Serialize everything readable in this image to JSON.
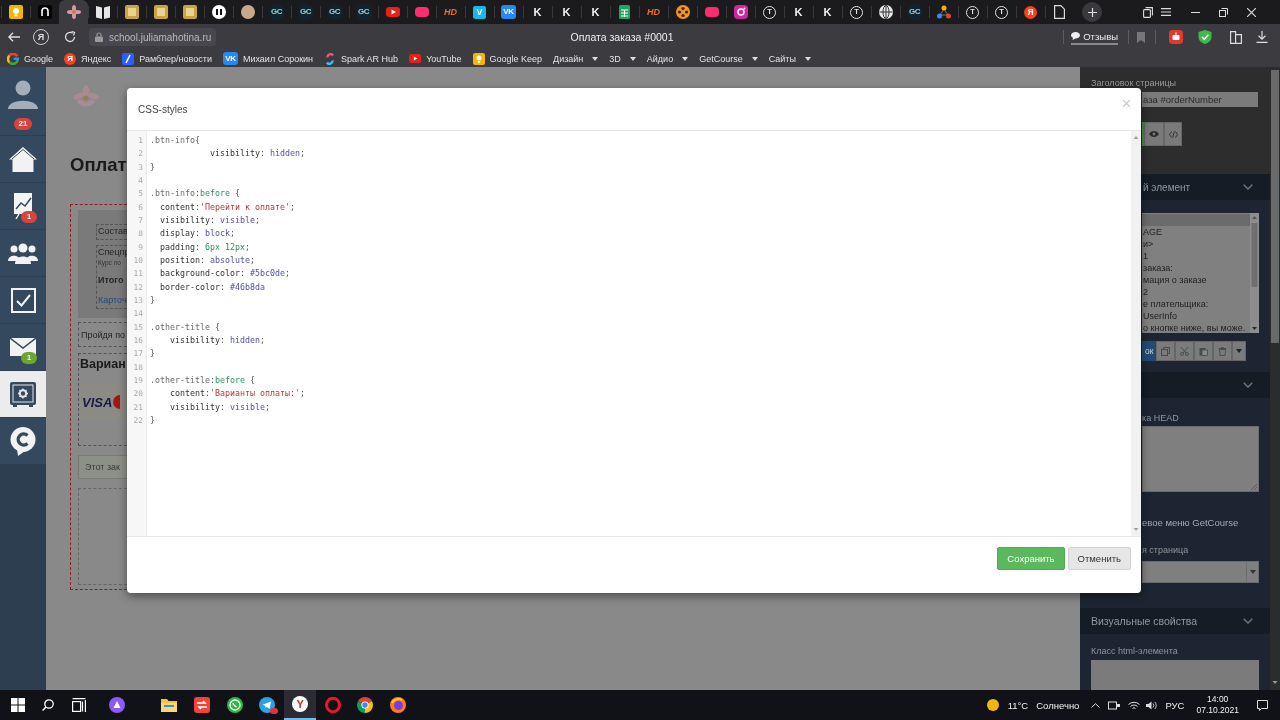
{
  "browser": {
    "tabs": [
      {
        "kind": "keep",
        "selected": false
      },
      {
        "kind": "portal",
        "selected": false
      },
      {
        "kind": "flower",
        "selected": true
      },
      {
        "kind": "book",
        "selected": false
      },
      {
        "kind": "frame",
        "selected": false
      },
      {
        "kind": "frame",
        "selected": false
      },
      {
        "kind": "frame",
        "selected": false
      },
      {
        "kind": "pause",
        "selected": false
      },
      {
        "kind": "avatar",
        "selected": false
      },
      {
        "kind": "gc",
        "glyph": "GC",
        "selected": false
      },
      {
        "kind": "gc",
        "glyph": "GC",
        "selected": false
      },
      {
        "kind": "gc",
        "glyph": "GC",
        "selected": false
      },
      {
        "kind": "gc",
        "glyph": "GC",
        "selected": false
      },
      {
        "kind": "youtube",
        "selected": false
      },
      {
        "kind": "blob",
        "selected": false
      },
      {
        "kind": "hd",
        "glyph": "HD",
        "selected": false
      },
      {
        "kind": "vimeo",
        "glyph": "V",
        "selected": false
      },
      {
        "kind": "vk",
        "glyph": "VK",
        "selected": false
      },
      {
        "kind": "k",
        "glyph": "K",
        "selected": false
      },
      {
        "kind": "k",
        "glyph": "K",
        "selected": false
      },
      {
        "kind": "k",
        "glyph": "K",
        "selected": false
      },
      {
        "kind": "sheet",
        "selected": false
      },
      {
        "kind": "hd",
        "glyph": "HD",
        "selected": false
      },
      {
        "kind": "reel",
        "selected": false
      },
      {
        "kind": "blob",
        "selected": false
      },
      {
        "kind": "instagram",
        "selected": false
      },
      {
        "kind": "t",
        "glyph": "T",
        "selected": false
      },
      {
        "kind": "k",
        "glyph": "K",
        "selected": false
      },
      {
        "kind": "k",
        "glyph": "K",
        "selected": false
      },
      {
        "kind": "t",
        "glyph": "T",
        "selected": false
      },
      {
        "kind": "globe",
        "selected": false
      },
      {
        "kind": "gc",
        "glyph": "GC",
        "selected": false
      },
      {
        "kind": "dots",
        "selected": false
      },
      {
        "kind": "t",
        "glyph": "T",
        "selected": false
      },
      {
        "kind": "t",
        "glyph": "T",
        "selected": false
      },
      {
        "kind": "ya",
        "glyph": "Я",
        "selected": false
      },
      {
        "kind": "doc",
        "selected": false
      }
    ],
    "address": {
      "home_glyph": "Я",
      "url": "school.juliamahotina.ru",
      "title": "Оплата заказа #0001",
      "reviews": "Отзывы"
    },
    "bookmarks": [
      {
        "kind": "google",
        "label": "Google"
      },
      {
        "kind": "yandex",
        "glyph": "Я",
        "label": "Яндекс"
      },
      {
        "kind": "rambler",
        "label": "Рамблер/новости"
      },
      {
        "kind": "vk",
        "glyph": "VK",
        "label": "Михаил Сорокин"
      },
      {
        "kind": "spark",
        "label": "Spark AR Hub"
      },
      {
        "kind": "youtube",
        "label": "YouTube"
      },
      {
        "kind": "keep",
        "label": "Google Keep"
      },
      {
        "kind": "folder",
        "label": "Дизайн"
      },
      {
        "kind": "folder",
        "label": "3D"
      },
      {
        "kind": "folder",
        "label": "Айдио"
      },
      {
        "kind": "folder",
        "label": "GetCourse"
      },
      {
        "kind": "folder",
        "label": "Сайты"
      }
    ]
  },
  "sidebar": {
    "notifications": "21",
    "items": [
      {
        "kind": "home",
        "selected": false
      },
      {
        "kind": "chart",
        "badge": "1",
        "color": "#d9433c",
        "selected": false
      },
      {
        "kind": "users",
        "selected": false
      },
      {
        "kind": "tasks",
        "selected": false
      },
      {
        "kind": "mail",
        "badge": "1",
        "color": "#6da532",
        "selected": false
      },
      {
        "kind": "safe",
        "selected": true
      },
      {
        "kind": "chat",
        "selected": false
      }
    ]
  },
  "page": {
    "title": "Оплат",
    "summary": [
      {
        "lines": [
          {
            "kind": "label",
            "text": "Состав"
          }
        ]
      },
      {
        "lines": [
          {
            "kind": "label",
            "text": "Спецпр"
          },
          {
            "kind": "small",
            "text": "Курс по"
          },
          {
            "kind": "total",
            "text": "Итого"
          },
          {
            "kind": "link",
            "text": "Карточ"
          }
        ]
      }
    ],
    "note": "Пройдя по",
    "payment_title": "Вариан",
    "card_logo": "VISA",
    "notice": "Этот зак"
  },
  "modal": {
    "title": "CSS-styles",
    "lines": [
      {
        "number": "1",
        "tokens": [
          {
            "kind": "qualifier",
            "text": ".btn-info"
          },
          {
            "kind": "plain",
            "text": "{"
          }
        ]
      },
      {
        "number": "2",
        "tokens": [
          {
            "kind": "property",
            "text": "            visibility"
          },
          {
            "kind": "plain",
            "text": ": "
          },
          {
            "kind": "atom",
            "text": "hidden"
          },
          {
            "kind": "plain",
            "text": ";"
          }
        ]
      },
      {
        "number": "3",
        "tokens": [
          {
            "kind": "plain",
            "text": "}"
          }
        ]
      },
      {
        "number": "4"
      },
      {
        "number": "5",
        "tokens": [
          {
            "kind": "qualifier",
            "text": ".btn-info"
          },
          {
            "kind": "plain",
            "text": ":"
          },
          {
            "kind": "pseudo",
            "text": "before"
          },
          {
            "kind": "plain",
            "text": " {"
          }
        ]
      },
      {
        "number": "6",
        "tokens": [
          {
            "kind": "property",
            "text": "  content"
          },
          {
            "kind": "plain",
            "text": ":"
          },
          {
            "kind": "string",
            "text": "'Перейти к оплате'"
          },
          {
            "kind": "plain",
            "text": ";"
          }
        ]
      },
      {
        "number": "7",
        "tokens": [
          {
            "kind": "property",
            "text": "  visibility"
          },
          {
            "kind": "plain",
            "text": ": "
          },
          {
            "kind": "atom",
            "text": "visible"
          },
          {
            "kind": "plain",
            "text": ";"
          }
        ]
      },
      {
        "number": "8",
        "tokens": [
          {
            "kind": "property",
            "text": "  display"
          },
          {
            "kind": "plain",
            "text": ": "
          },
          {
            "kind": "atom",
            "text": "block"
          },
          {
            "kind": "plain",
            "text": ";"
          }
        ]
      },
      {
        "number": "9",
        "tokens": [
          {
            "kind": "property",
            "text": "  padding"
          },
          {
            "kind": "plain",
            "text": ": "
          },
          {
            "kind": "number",
            "text": "6px 12px"
          },
          {
            "kind": "plain",
            "text": ";"
          }
        ]
      },
      {
        "number": "10",
        "tokens": [
          {
            "kind": "property",
            "text": "  position"
          },
          {
            "kind": "plain",
            "text": ": "
          },
          {
            "kind": "atom",
            "text": "absolute"
          },
          {
            "kind": "plain",
            "text": ";"
          }
        ]
      },
      {
        "number": "11",
        "tokens": [
          {
            "kind": "property",
            "text": "  background-color"
          },
          {
            "kind": "plain",
            "text": ": "
          },
          {
            "kind": "atom",
            "text": "#5bc0de"
          },
          {
            "kind": "plain",
            "text": ";"
          }
        ]
      },
      {
        "number": "12",
        "tokens": [
          {
            "kind": "property",
            "text": "  border-color"
          },
          {
            "kind": "plain",
            "text": ": "
          },
          {
            "kind": "atom",
            "text": "#46b8da"
          }
        ]
      },
      {
        "number": "13",
        "tokens": [
          {
            "kind": "plain",
            "text": "}"
          }
        ]
      },
      {
        "number": "14"
      },
      {
        "number": "15",
        "tokens": [
          {
            "kind": "qualifier",
            "text": ".other-title"
          },
          {
            "kind": "plain",
            "text": " {"
          }
        ]
      },
      {
        "number": "16",
        "tokens": [
          {
            "kind": "property",
            "text": "    visibility"
          },
          {
            "kind": "plain",
            "text": ": "
          },
          {
            "kind": "atom",
            "text": "hidden"
          },
          {
            "kind": "plain",
            "text": ";"
          }
        ]
      },
      {
        "number": "17",
        "tokens": [
          {
            "kind": "plain",
            "text": "}"
          }
        ]
      },
      {
        "number": "18"
      },
      {
        "number": "19",
        "tokens": [
          {
            "kind": "qualifier",
            "text": ".other-title"
          },
          {
            "kind": "plain",
            "text": ":"
          },
          {
            "kind": "pseudo",
            "text": "before"
          },
          {
            "kind": "plain",
            "text": " {"
          }
        ]
      },
      {
        "number": "20",
        "tokens": [
          {
            "kind": "property",
            "text": "    content"
          },
          {
            "kind": "plain",
            "text": ":"
          },
          {
            "kind": "string",
            "text": "'Варианты оплаты:'"
          },
          {
            "kind": "plain",
            "text": ";"
          }
        ]
      },
      {
        "number": "21",
        "tokens": [
          {
            "kind": "property",
            "text": "    visibility"
          },
          {
            "kind": "plain",
            "text": ": "
          },
          {
            "kind": "atom",
            "text": "visible"
          },
          {
            "kind": "plain",
            "text": ";"
          }
        ]
      },
      {
        "number": "22",
        "tokens": [
          {
            "kind": "plain",
            "text": "}"
          }
        ]
      }
    ],
    "buttons": [
      {
        "kind": "primary",
        "label": "Сохранить"
      },
      {
        "kind": "default",
        "label": "Отменить"
      }
    ]
  },
  "right_panel": {
    "title_label": "Заголовок страницы",
    "title_value": "аза #orderNumber",
    "element_section": "й элемент",
    "tree": [
      {
        "selected": true
      },
      {
        "text": "AGE",
        "selected": false
      },
      {
        "text": "и>",
        "selected": false
      },
      {
        "text": "1",
        "selected": false
      },
      {
        "text": "заказа:",
        "selected": false
      },
      {
        "text": "мация о заказе",
        "selected": false
      },
      {
        "text": "2",
        "selected": false
      },
      {
        "text": "е плательщика:",
        "selected": false
      },
      {
        "text": "UserInfo",
        "selected": false
      },
      {
        "text": "о кнопке ниже, вы може.",
        "selected": false
      }
    ],
    "tree_button": "ок",
    "head_label": "ка HEAD",
    "menu_option": "евое меню GetCourse",
    "page_label": "я страница",
    "visual_section": "Визуальные свойства",
    "class_label": "Класс html-элемента"
  },
  "taskbar": {
    "apps": [
      {
        "kind": "start",
        "selected": false
      },
      {
        "kind": "search",
        "selected": false
      },
      {
        "kind": "taskview",
        "selected": false
      },
      {
        "kind": "assistant",
        "selected": false
      },
      {
        "kind": "folder",
        "selected": false
      },
      {
        "kind": "remote",
        "selected": false
      },
      {
        "kind": "whatsapp",
        "selected": false
      },
      {
        "kind": "telegram",
        "badge": true,
        "selected": false
      },
      {
        "kind": "yandex",
        "glyph": "Y",
        "selected": true
      },
      {
        "kind": "opera",
        "selected": false
      },
      {
        "kind": "chrome",
        "selected": false
      },
      {
        "kind": "firefox",
        "selected": false
      }
    ],
    "weather": {
      "temp": "11°C",
      "summary": "Солнечно"
    },
    "language": "РУС",
    "time": "14:00",
    "date": "07.10.2021"
  }
}
